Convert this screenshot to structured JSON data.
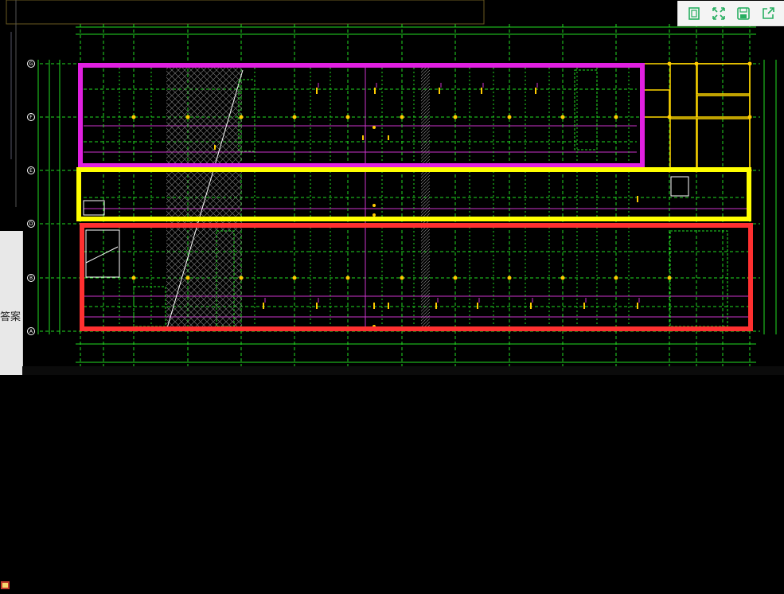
{
  "toolbar": {
    "buttons": [
      {
        "name": "fit-page-button",
        "icon": "fit-page-icon"
      },
      {
        "name": "fullscreen-button",
        "icon": "expand-icon"
      },
      {
        "name": "save-button",
        "icon": "save-icon"
      },
      {
        "name": "share-button",
        "icon": "share-icon"
      }
    ],
    "icon_color": "#27ae60"
  },
  "side_panel": {
    "label": "答案"
  },
  "drawing": {
    "grid_axes": [
      "G",
      "F",
      "E",
      "D",
      "B",
      "A"
    ],
    "highlight_colors": {
      "magenta": "#e020e0",
      "yellow": "#ffff00",
      "red": "#ff3030"
    },
    "line_colors": {
      "green": "#22dd22",
      "magenta": "#cc33cc",
      "yellow": "#ffd700",
      "white": "#ffffff"
    }
  }
}
